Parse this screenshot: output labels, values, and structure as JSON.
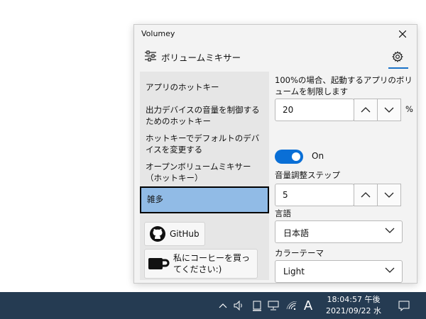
{
  "window": {
    "title": "Volumey",
    "header_title": "ボリュームミキサー"
  },
  "sidebar": {
    "items": [
      {
        "label": "アプリのホットキー"
      },
      {
        "label": "出力デバイスの音量を制御するためのホットキー"
      },
      {
        "label": "ホットキーでデフォルトのデバイスを変更する"
      },
      {
        "label": "オープンボリュームミキサー（ホットキー）"
      },
      {
        "label": "雑多"
      }
    ],
    "selected_index": 4,
    "github_label": "GitHub",
    "coffee_label": "私にコーヒーを買ってください:)"
  },
  "settings": {
    "limit_label": "100%の場合、起動するアプリのボリュームを制限します",
    "limit_value": "20",
    "limit_unit": "%",
    "toggle_state": "On",
    "step_label": "音量調整ステップ",
    "step_value": "5",
    "language_label": "言語",
    "language_value": "日本語",
    "theme_label": "カラーテーマ",
    "theme_value": "Light"
  },
  "taskbar": {
    "ime_label": "A",
    "time": "18:04:57 午後",
    "date": "2021/09/22 水"
  },
  "colors": {
    "accent": "#0a6fd6",
    "selected_bg": "#91bbe6",
    "taskbar_bg": "#253b52"
  }
}
